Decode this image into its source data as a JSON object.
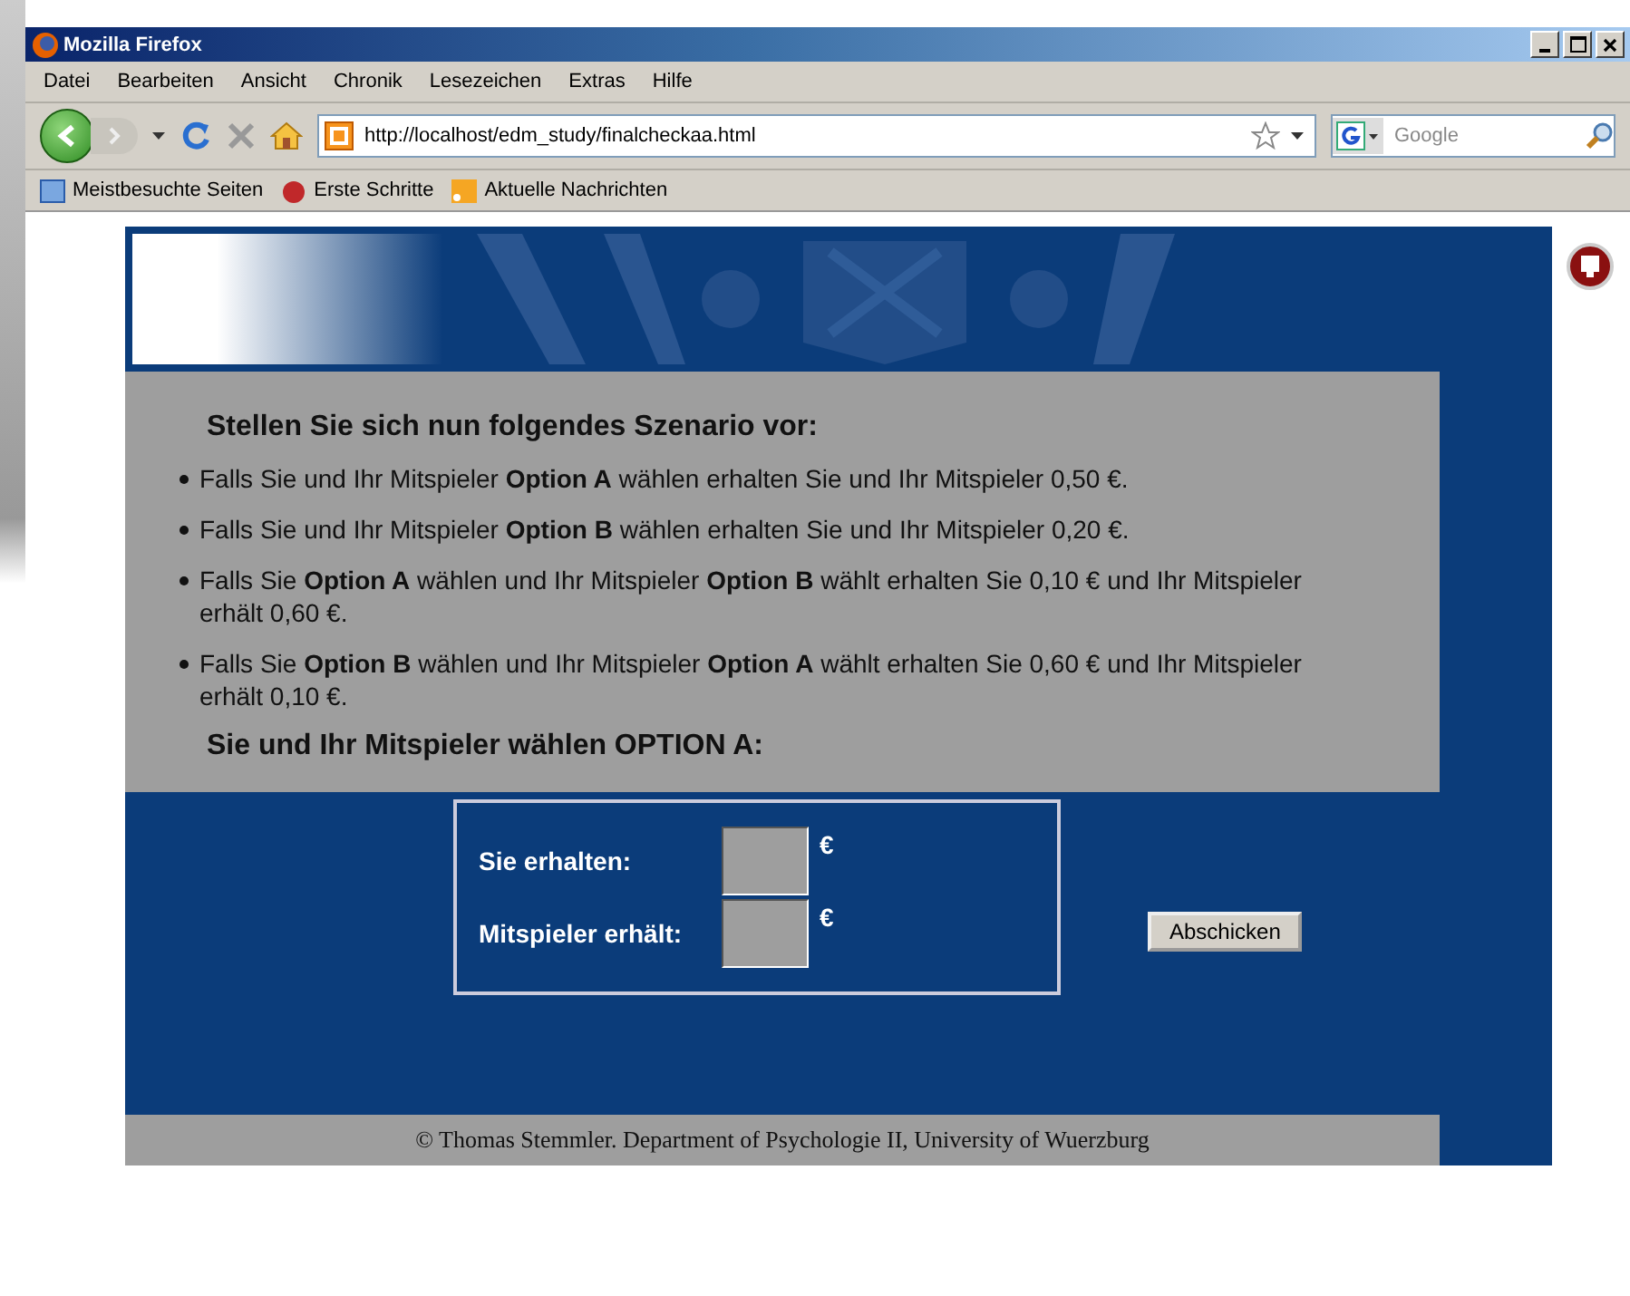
{
  "window": {
    "title": "Mozilla Firefox"
  },
  "menu": [
    "Datei",
    "Bearbeiten",
    "Ansicht",
    "Chronik",
    "Lesezeichen",
    "Extras",
    "Hilfe"
  ],
  "address_bar": {
    "value": "http://localhost/edm_study/finalcheckaa.html"
  },
  "search": {
    "placeholder": "Google"
  },
  "bookmarks": [
    "Meistbesuchte Seiten",
    "Erste Schritte",
    "Aktuelle Nachrichten"
  ],
  "page": {
    "heading": "Stellen Sie sich nun folgendes Szenario vor:",
    "bullets": [
      "Falls Sie und Ihr Mitspieler **Option A** wählen erhalten Sie und Ihr Mitspieler 0,50 €.",
      "Falls Sie und Ihr Mitspieler **Option B** wählen erhalten Sie und Ihr Mitspieler 0,20 €.",
      "Falls Sie **Option A** wählen und Ihr Mitspieler **Option B** wählt erhalten Sie 0,10 € und Ihr Mitspieler erhält 0,60 €.",
      "Falls Sie **Option B** wählen und Ihr Mitspieler **Option A** wählt erhalten Sie 0,60 € und Ihr Mitspieler erhält 0,10 €."
    ],
    "result": "Sie und Ihr Mitspieler wählen OPTION A:",
    "form": {
      "fields": [
        {
          "label": "Sie erhalten:",
          "unit": "€"
        },
        {
          "label": "Mitspieler erhält:",
          "unit": "€"
        }
      ],
      "submit": "Abschicken"
    },
    "footer": "© Thomas Stemmler. Department of Psychologie II, University of Wuerzburg"
  }
}
